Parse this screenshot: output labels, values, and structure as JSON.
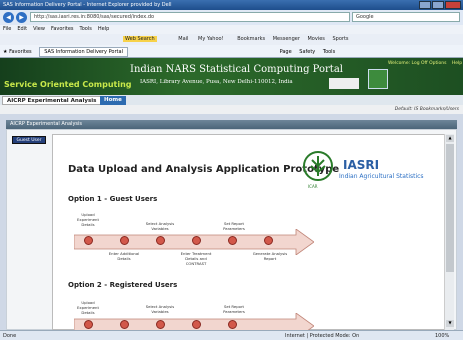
{
  "window": {
    "title": "SAS Information Delivery Portal - Internet Explorer provided by Dell"
  },
  "address": {
    "url": "http://sas.iasri.res.in:8080/sas/secured/index.do",
    "search_placeholder": "Google"
  },
  "menu": [
    "File",
    "Edit",
    "View",
    "Favorites",
    "Tools",
    "Help"
  ],
  "toolbar": {
    "web_search": "Web Search",
    "mail": "Mail",
    "my_yahoo": "My Yahoo!",
    "bookmarks": "Bookmarks",
    "messenger": "Messenger",
    "movies": "Movies",
    "sports": "Sports"
  },
  "favorites": {
    "label": "Favorites",
    "tab": "SAS Information Delivery Portal",
    "page": "Page",
    "safety": "Safety",
    "tools": "Tools"
  },
  "banner": {
    "service": "Service Oriented Computing",
    "title": "Indian NARS Statistical Computing Portal",
    "address": "IASRI, Library Avenue, Pusa, New Delhi-110012, India",
    "welcome": "Welcome: Log Off          Options",
    "help": "Help"
  },
  "tabs": {
    "first": "AICRP Experimental Analysis",
    "second": "Home"
  },
  "default_text": "Default: IS Bookmarks/Users",
  "portlet": {
    "title": "AICRP Experimental Analysis"
  },
  "sidebar": {
    "guest_button": "Guest User"
  },
  "content": {
    "title": "Data Upload and Analysis Application Prototype",
    "icar": "ICAR",
    "iasri": "IASRI",
    "iasri_sub": "Indian Agricultural Statistics",
    "option1": {
      "title": "Option 1 - Guest Users",
      "top_labels": [
        "Upload Experiment Details",
        "Select Analysis Variables",
        "Set Report Parameters"
      ],
      "bottom_labels": [
        "Enter Additional Details",
        "Enter Treatment Details and CONTRAST",
        "Generate Analysis Report"
      ]
    },
    "option2": {
      "title": "Option 2 - Registered Users",
      "top_labels": [
        "Upload Experiment Details",
        "Select Analysis Variables",
        "Set Report Parameters"
      ]
    }
  },
  "status": {
    "left": "Done",
    "zone": "Internet | Protected Mode: On",
    "zoom": "100%"
  }
}
